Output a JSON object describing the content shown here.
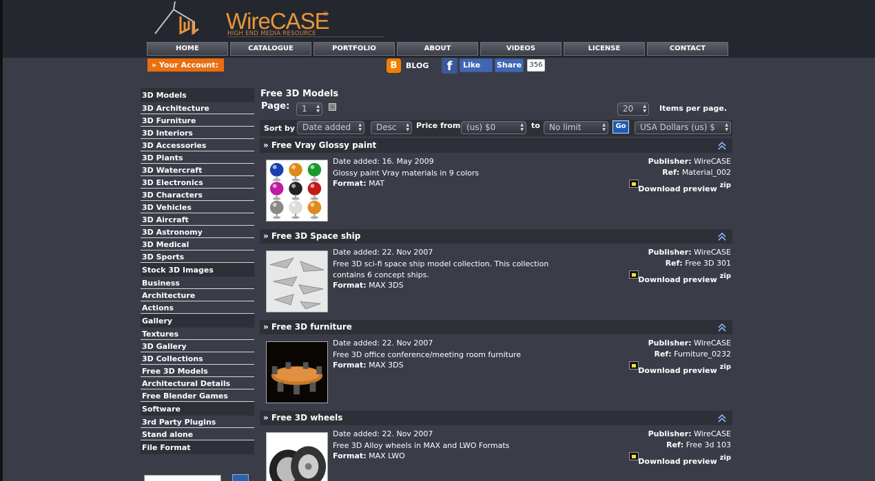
{
  "logo": {
    "word": "WireCASE",
    "reg": "®",
    "tagline": "HIGH END MEDIA RESOURCE"
  },
  "nav": [
    "HOME",
    "CATALOGUE",
    "PORTFOLIO",
    "ABOUT",
    "VIDEOS",
    "LICENSE",
    "CONTACT"
  ],
  "account": "» Your Account:",
  "social": {
    "blog": "BLOG",
    "like": "Like",
    "share": "Share",
    "share_count": "356"
  },
  "sidebar": [
    {
      "label": "3D Models",
      "head": true
    },
    {
      "label": "3D Architecture"
    },
    {
      "label": "3D Furniture"
    },
    {
      "label": "3D Interiors"
    },
    {
      "label": "3D Accessories"
    },
    {
      "label": "3D Plants"
    },
    {
      "label": "3D Watercraft"
    },
    {
      "label": "3D Electronics"
    },
    {
      "label": "3D Characters"
    },
    {
      "label": "3D Vehicles"
    },
    {
      "label": "3D Aircraft"
    },
    {
      "label": "3D Astronomy"
    },
    {
      "label": "3D Medical"
    },
    {
      "label": "3D Sports"
    },
    {
      "label": "Stock 3D Images",
      "head": true
    },
    {
      "label": "Business"
    },
    {
      "label": "Architecture"
    },
    {
      "label": "Actions"
    },
    {
      "label": "Gallery",
      "head": true
    },
    {
      "label": "Textures"
    },
    {
      "label": "3D Gallery"
    },
    {
      "label": "3D Collections"
    },
    {
      "label": "Free 3D Models"
    },
    {
      "label": "Architectural Details"
    },
    {
      "label": "Free Blender Games"
    },
    {
      "label": "Software",
      "head": true
    },
    {
      "label": "3rd Party Plugins"
    },
    {
      "label": "Stand alone"
    },
    {
      "label": "File Format",
      "head": true
    }
  ],
  "main": {
    "title": "Free 3D Models",
    "page_label": "Page:",
    "page_value": "1",
    "items_per_page": "20",
    "items_label": "Items per page.",
    "sort_label": "Sort by",
    "sort_value": "Date added",
    "order_value": "Desc",
    "price_from_label": "Price from",
    "price_from_value": "(us) $0",
    "to_label": "to",
    "price_to_value": "No limit",
    "go": "Go",
    "currency": "USA Dollars (us) $"
  },
  "labels": {
    "date_added": "Date added:",
    "format": "Format:",
    "publisher": "Publisher:",
    "ref": "Ref:",
    "download": "Download preview",
    "zip": "zip"
  },
  "products": [
    {
      "title": "» Free Vray Glossy paint",
      "date": "16. May 2009",
      "desc": "Glossy paint Vray materials in 9 colors",
      "format": "MAT",
      "publisher": "WireCASE",
      "ref": "Material_002",
      "thumb": "paint-spheres"
    },
    {
      "title": "» Free 3D Space ship",
      "date": "22. Nov 2007",
      "desc": "Free 3D sci-fi space ship model collection. This collection contains 6 concept ships.",
      "format": "MAX   3DS",
      "publisher": "WireCASE",
      "ref": "Free 3D 301",
      "thumb": "space-ships"
    },
    {
      "title": "» Free 3D furniture",
      "date": "22. Nov 2007",
      "desc": "Free 3D office conference/meeting room furniture",
      "format": "MAX   3DS",
      "publisher": "WireCASE",
      "ref": "Furniture_0232",
      "thumb": "conference-table"
    },
    {
      "title": "» Free 3D wheels",
      "date": "22. Nov 2007",
      "desc": "Free 3D Alloy wheels in MAX and LWO Formats",
      "format": "MAX   LWO",
      "publisher": "WireCASE",
      "ref": "Free 3d 103",
      "thumb": "alloy-wheels"
    }
  ],
  "colors": {
    "accent": "#e96f10",
    "background": "#3a3d48",
    "header": "#25272e",
    "bar": "#2e3038",
    "go": "#1f5bb8"
  }
}
